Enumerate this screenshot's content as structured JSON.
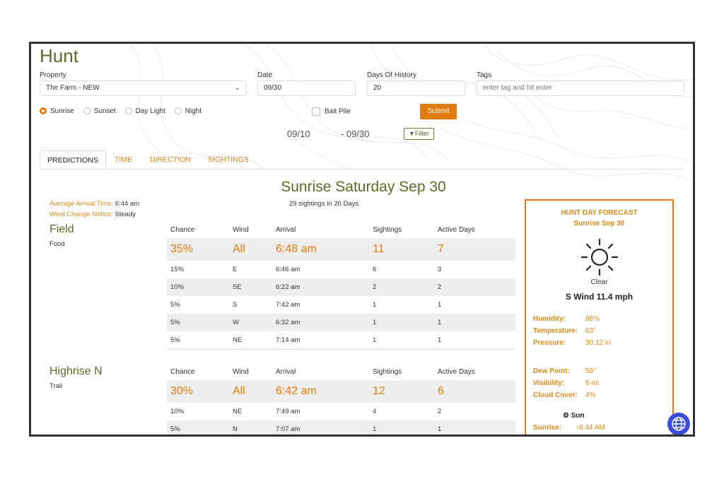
{
  "page": {
    "title": "Hunt"
  },
  "filters": {
    "property_label": "Property",
    "property_value": "The Farm - NEW",
    "date_label": "Date",
    "date_value": "09/30",
    "days_label": "Days Of History",
    "days_value": "20",
    "tags_label": "Tags",
    "tags_placeholder": "enter tag and hit enter",
    "radios": [
      "Sunrise",
      "Sunset",
      "Day Light",
      "Night"
    ],
    "selected_radio": "Sunrise",
    "bait_pile_label": "Bait Pile",
    "submit_label": "Submit",
    "range_start": "09/10",
    "range_end": "- 09/30",
    "filter_label": "Filter"
  },
  "tabs": [
    "PREDICTIONS",
    "TIME",
    "DIRECTION",
    "SIGHTINGS"
  ],
  "active_tab": "PREDICTIONS",
  "summary": {
    "heading": "Sunrise Saturday Sep 30",
    "avg_arrival_label": "Average Arrival Time:",
    "avg_arrival_value": "6:44 am",
    "wind_change_label": "Wind Change Notice:",
    "wind_change_value": "Steady",
    "sightings_summary": "29 sightings in 20 Days"
  },
  "columns": [
    "Chance",
    "Wind",
    "Arrival",
    "Sightings",
    "Active Days"
  ],
  "locations": [
    {
      "name": "Field",
      "type": "Food",
      "rows": [
        [
          "35%",
          "All",
          "6:48 am",
          "11",
          "7"
        ],
        [
          "15%",
          "E",
          "6:46 am",
          "6",
          "3"
        ],
        [
          "10%",
          "SE",
          "6:22 am",
          "2",
          "2"
        ],
        [
          "5%",
          "S",
          "7:42 am",
          "1",
          "1"
        ],
        [
          "5%",
          "W",
          "6:32 am",
          "1",
          "1"
        ],
        [
          "5%",
          "NE",
          "7:14 am",
          "1",
          "1"
        ]
      ]
    },
    {
      "name": "Highrise N",
      "type": "Trail",
      "rows": [
        [
          "30%",
          "All",
          "6:42 am",
          "12",
          "6"
        ],
        [
          "10%",
          "NE",
          "7:49 am",
          "4",
          "2"
        ],
        [
          "5%",
          "N",
          "7:07 am",
          "1",
          "1"
        ]
      ]
    }
  ],
  "forecast": {
    "title": "HUNT DAY FORECAST",
    "subtitle": "Sunrise Sep 30",
    "condition": "Clear",
    "wind": "S Wind 11.4 mph",
    "humidity_label": "Humidity:",
    "humidity_value": "88%",
    "temperature_label": "Temperature:",
    "temperature_value": "63°",
    "pressure_label": "Pressure:",
    "pressure_value": "30.12 in",
    "dew_label": "Dew Point:",
    "dew_value": "59°",
    "visibility_label": "Visibility:",
    "visibility_value": "6 mi",
    "cloud_label": "Cloud Cover:",
    "cloud_value": "4%",
    "sun_label": "Sun",
    "sunrise_label": "Sunrise:",
    "sunrise_value": "6:44 AM"
  },
  "colors": {
    "accent": "#e07b10",
    "brand_green": "#5a6b2a",
    "row_shade": "#eeeeee"
  }
}
